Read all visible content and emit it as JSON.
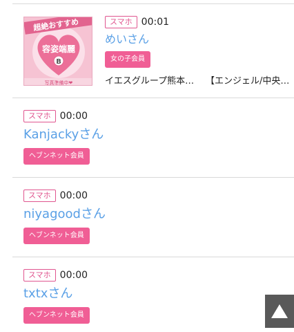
{
  "entries": [
    {
      "device": "スマホ",
      "time": "00:01",
      "name": "めいさん",
      "badge": "女の子会員",
      "shop": "イエスグループ熊本…",
      "area": "【エンジェル/中央…",
      "thumb": {
        "banner": "超絶おすすめ",
        "heart_text": "容姿端麗",
        "cup": "B",
        "footer": "写真準備中❤"
      }
    },
    {
      "device": "スマホ",
      "time": "00:00",
      "name": "Kanjackyさん",
      "badge": "ヘブンネット会員"
    },
    {
      "device": "スマホ",
      "time": "00:00",
      "name": "niyagoodさん",
      "badge": "ヘブンネット会員"
    },
    {
      "device": "スマホ",
      "time": "00:00",
      "name": "txtxさん",
      "badge": "ヘブンネット会員"
    }
  ],
  "scroll_top": {
    "icon": "triangle-up-icon"
  },
  "colors": {
    "accent_pink": "#f05e95",
    "name_blue": "#5aa0e6",
    "scroll_bg": "#595959"
  }
}
